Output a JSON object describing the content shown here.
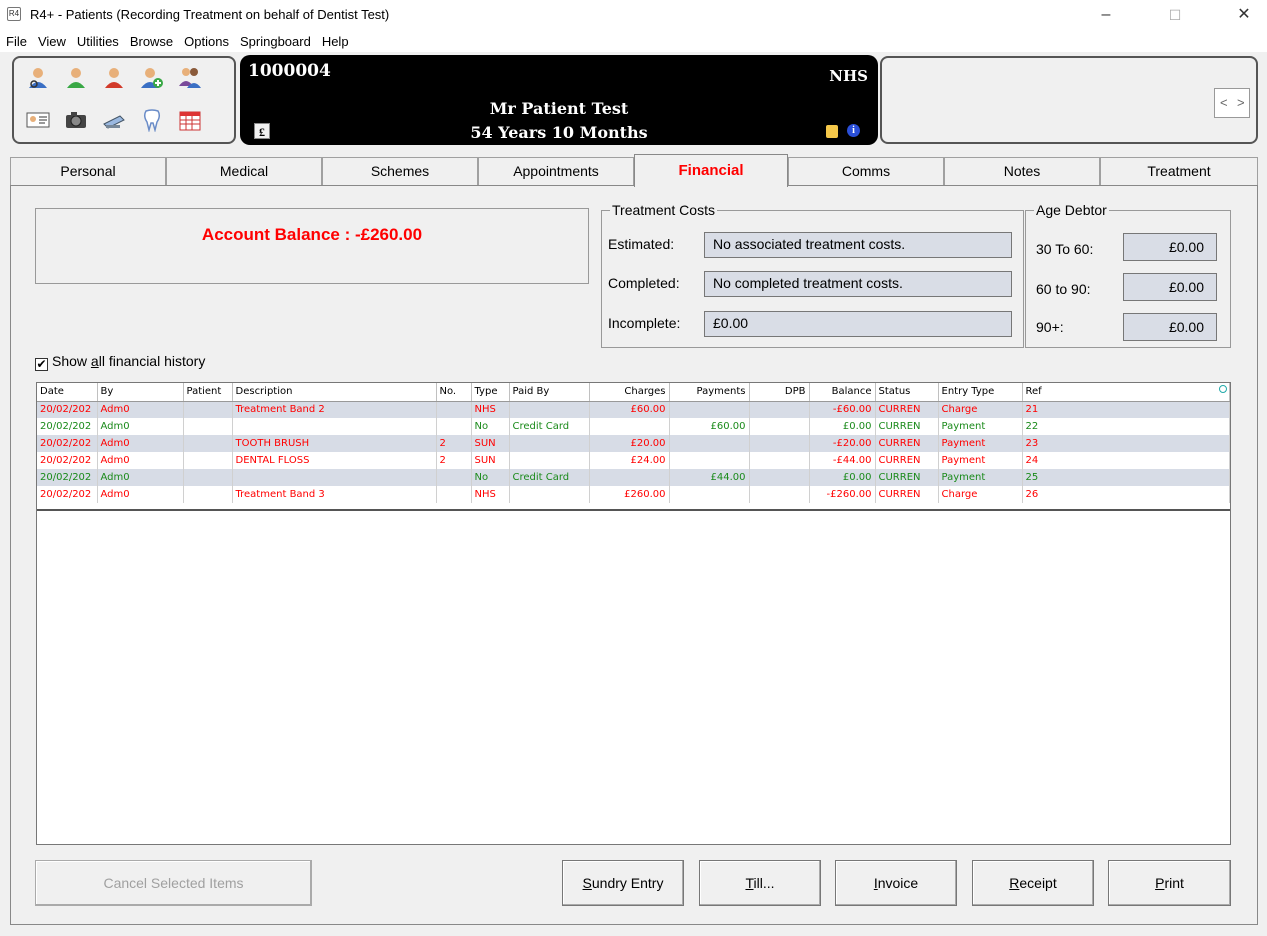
{
  "window": {
    "title": "R4+ - Patients (Recording Treatment on behalf of Dentist Test)",
    "app_icon": "R4",
    "minimize": "–",
    "maximize": "☐",
    "close": "✕"
  },
  "menu": [
    "File",
    "View",
    "Utilities",
    "Browse",
    "Options",
    "Springboard",
    "Help"
  ],
  "toolbar_icons": [
    "find-patient-icon",
    "patient-green-icon",
    "patient-red-icon",
    "add-patient-icon",
    "family-icon",
    "id-card-icon",
    "camera-icon",
    "scanner-icon",
    "tooth-icon",
    "calendar-icon"
  ],
  "patient": {
    "id": "1000004",
    "scheme": "NHS",
    "name": "Mr Patient Test",
    "age": "54 Years 10 Months",
    "pound_symbol": "£"
  },
  "tabs": [
    "Personal",
    "Medical",
    "Schemes",
    "Appointments",
    "Financial",
    "Comms",
    "Notes",
    "Treatment"
  ],
  "active_tab": "Financial",
  "account": {
    "balance_text": "Account Balance : -£260.00"
  },
  "treatment_costs": {
    "title": "Treatment Costs",
    "estimated_label": "Estimated:",
    "estimated_value": "No associated treatment costs.",
    "completed_label": "Completed:",
    "completed_value": "No completed treatment costs.",
    "incomplete_label": "Incomplete:",
    "incomplete_value": "£0.00"
  },
  "age_debtor": {
    "title": "Age Debtor",
    "r1_label": "30 To 60:",
    "r1_value": "£0.00",
    "r2_label": "60 to 90:",
    "r2_value": "£0.00",
    "r3_label": "90+:",
    "r3_value": "£0.00"
  },
  "history_checkbox": {
    "pre": "Show ",
    "accel": "a",
    "post": "ll financial history",
    "checked": "✔"
  },
  "table": {
    "columns": [
      "Date",
      "By",
      "Patient",
      "Description",
      "No.",
      "Type",
      "Paid By",
      "Charges",
      "Payments",
      "DPB",
      "Balance",
      "Status",
      "Entry Type",
      "Ref"
    ],
    "rows": [
      {
        "color": "red",
        "cells": [
          "20/02/202",
          "Adm0",
          "",
          "Treatment Band 2",
          "",
          "NHS",
          "",
          "£60.00",
          "",
          "",
          "-£60.00",
          "CURREN",
          "Charge",
          "21"
        ]
      },
      {
        "color": "green",
        "cells": [
          "20/02/202",
          "Adm0",
          "",
          "",
          "",
          "No",
          "Credit Card",
          "",
          "£60.00",
          "",
          "£0.00",
          "CURREN",
          "Payment",
          "22"
        ]
      },
      {
        "color": "red",
        "cells": [
          "20/02/202",
          "Adm0",
          "",
          "TOOTH BRUSH",
          "2",
          "SUN",
          "",
          "£20.00",
          "",
          "",
          "-£20.00",
          "CURREN",
          "Payment",
          "23"
        ]
      },
      {
        "color": "red",
        "cells": [
          "20/02/202",
          "Adm0",
          "",
          "DENTAL FLOSS",
          "2",
          "SUN",
          "",
          "£24.00",
          "",
          "",
          "-£44.00",
          "CURREN",
          "Payment",
          "24"
        ]
      },
      {
        "color": "green",
        "cells": [
          "20/02/202",
          "Adm0",
          "",
          "",
          "",
          "No",
          "Credit Card",
          "",
          "£44.00",
          "",
          "£0.00",
          "CURREN",
          "Payment",
          "25"
        ]
      },
      {
        "color": "red",
        "cells": [
          "20/02/202",
          "Adm0",
          "",
          "Treatment Band 3",
          "",
          "NHS",
          "",
          "£260.00",
          "",
          "",
          "-£260.00",
          "CURREN",
          "Charge",
          "26"
        ]
      }
    ]
  },
  "buttons": {
    "cancel": "Cancel Selected Items",
    "sundry_pre": "",
    "sundry_accel": "S",
    "sundry_post": "undry Entry",
    "till_accel": "T",
    "till_post": "ill...",
    "invoice_pre": "",
    "invoice_accel": "I",
    "invoice_post": "nvoice",
    "receipt_accel": "R",
    "receipt_post": "eceipt",
    "print_accel": "P",
    "print_post": "rint"
  }
}
